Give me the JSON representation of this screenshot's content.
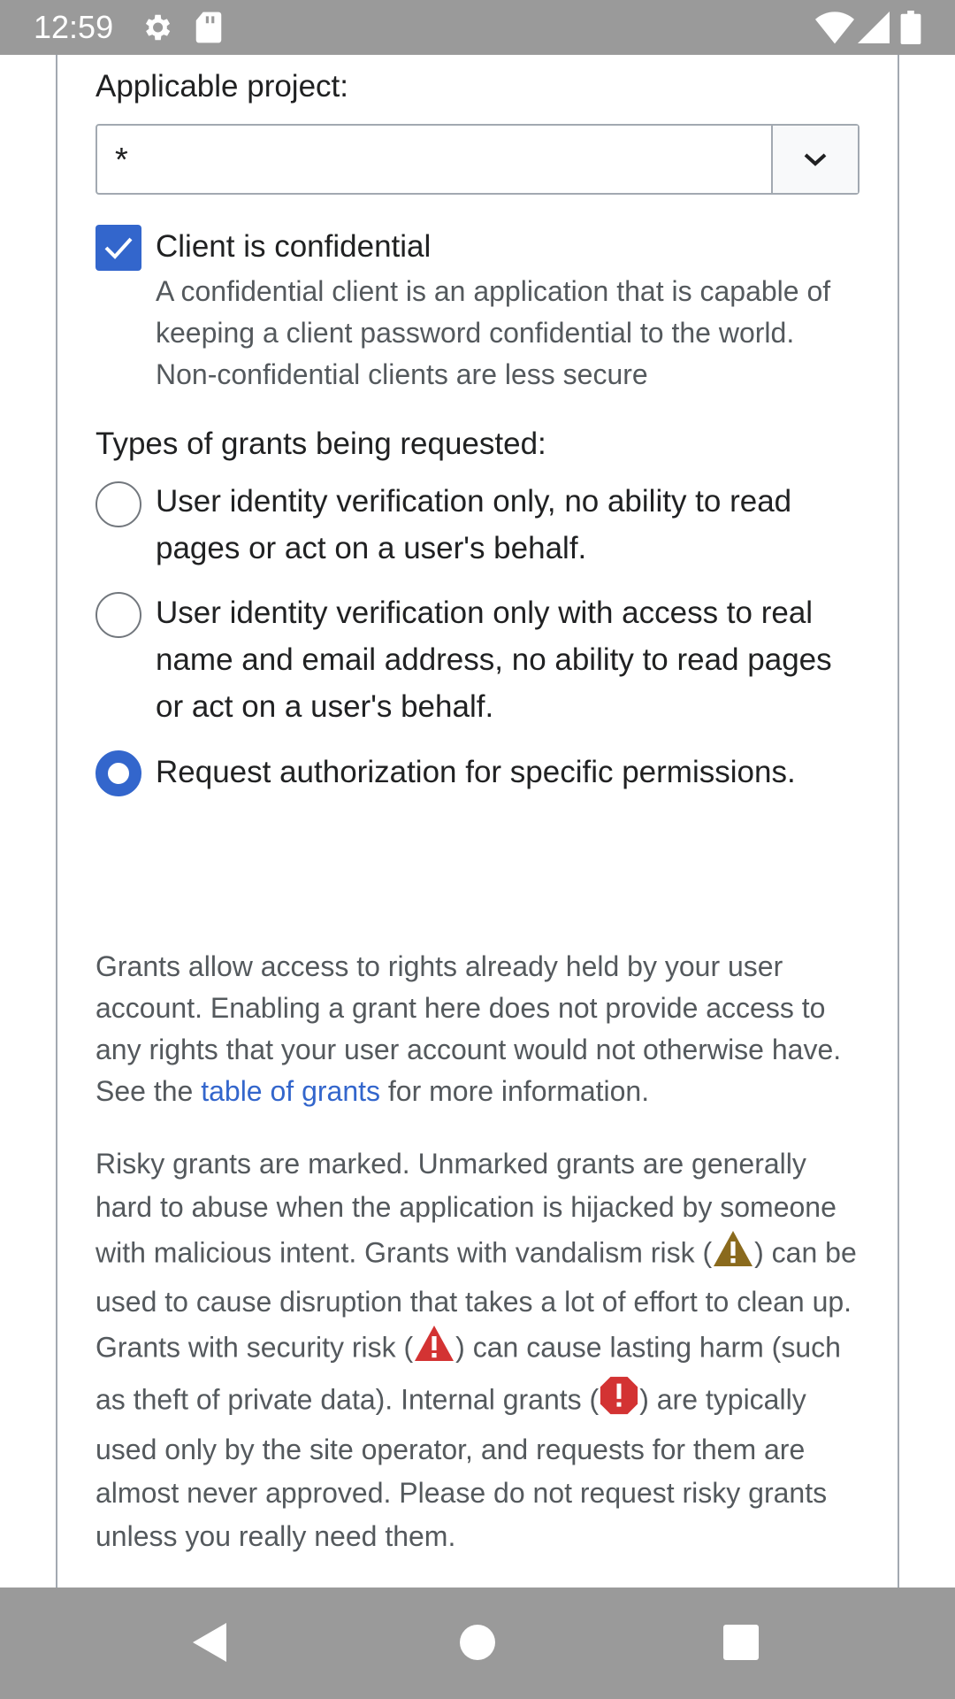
{
  "status_bar": {
    "time": "12:59",
    "icons": [
      "settings-icon",
      "sd-card-icon",
      "wifi-icon",
      "signal-icon",
      "battery-icon"
    ]
  },
  "form": {
    "applicable_project_label": "Applicable project:",
    "applicable_project_value": "*",
    "confidential_label": "Client is confidential",
    "confidential_checked": true,
    "confidential_help": "A confidential client is an application that is capable of keeping a client password confidential to the world. Non-confidential clients are less secure",
    "grants_label": "Types of grants being requested:",
    "grant_options": [
      {
        "label": "User identity verification only, no ability to read pages or act on a user's behalf.",
        "checked": false
      },
      {
        "label": "User identity verification only with access to real name and email address, no ability to read pages or act on a user's behalf.",
        "checked": false
      },
      {
        "label": "Request authorization for specific permissions.",
        "checked": true
      }
    ]
  },
  "info": {
    "grants_para_before": "Grants allow access to rights already held by your user account. Enabling a grant here does not provide access to any rights that your user account would not otherwise have. See the ",
    "grants_link": "table of grants",
    "grants_para_after": " for more information.",
    "risky_1": "Risky grants are marked. Unmarked grants are generally hard to abuse when the application is hijacked by someone with malicious intent. Grants with vandalism risk (",
    "risky_2": ") can be used to cause disruption that takes a lot of effort to clean up. Grants with security risk (",
    "risky_3": ") can cause lasting harm (such as theft of private data). Internal grants (",
    "risky_4": ") are typically used only by the site operator, and requests for them are almost never approved. Please do not request risky grants unless you really need them."
  },
  "colors": {
    "accent": "#3366cc",
    "vandalism_icon": "#8a6a1d",
    "security_icon": "#d33333",
    "internal_icon": "#d33333",
    "system_bars": "#9a9a9a"
  },
  "nav_bar": {
    "icons": [
      "back-icon",
      "home-icon",
      "recents-icon"
    ]
  }
}
